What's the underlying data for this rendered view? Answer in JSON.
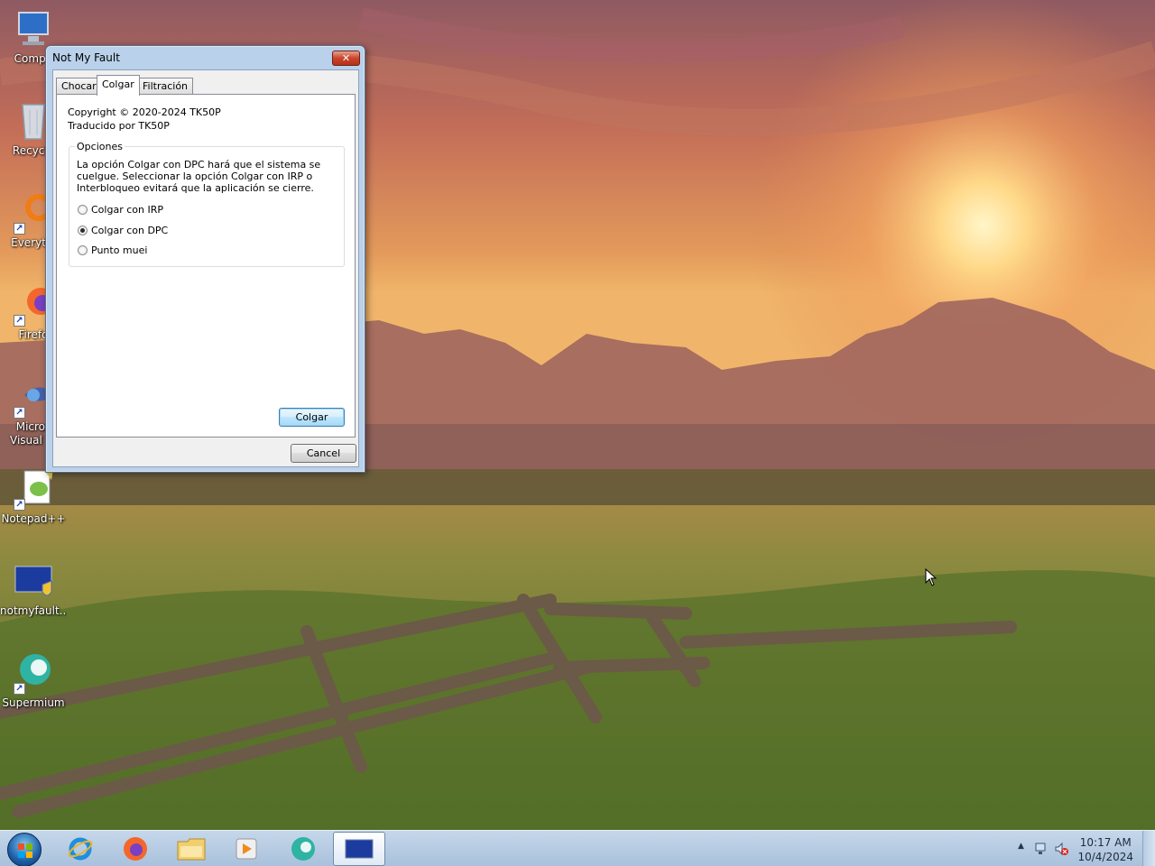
{
  "desktop": {
    "icons": [
      {
        "label": "Compu",
        "icon": "computer-icon"
      },
      {
        "label": "Recycle",
        "icon": "recycle-bin-icon"
      },
      {
        "label": "Everythi",
        "icon": "everything-icon"
      },
      {
        "label": "Firefo",
        "icon": "firefox-icon"
      },
      {
        "label": "Micros",
        "label2": "Visual St",
        "icon": "visual-studio-icon"
      },
      {
        "label": "Notepad++",
        "icon": "notepadpp-icon"
      },
      {
        "label": "notmyfault...",
        "icon": "notmyfault-icon"
      },
      {
        "label": "Supermium",
        "icon": "supermium-icon"
      }
    ]
  },
  "dialog": {
    "title": "Not My Fault",
    "close_label": "✕",
    "tabs": [
      "Chocar",
      "Colgar",
      "Filtración"
    ],
    "active_tab": "Colgar",
    "copyright": "Copyright © 2020-2024 TK50P",
    "translated": "Traducido por TK50P",
    "group": {
      "label": "Opciones",
      "description": "La opción Colgar con DPC hará que el sistema se cuelgue. Seleccionar la opción Colgar con IRP o Interbloqueo evitará que la aplicación se cierre.",
      "options": [
        {
          "label": "Colgar con IRP",
          "checked": false
        },
        {
          "label": "Colgar con DPC",
          "checked": true
        },
        {
          "label": "Punto muei",
          "checked": false
        }
      ]
    },
    "action_button": "Colgar",
    "cancel_button": "Cancel"
  },
  "taskbar": {
    "pinned": [
      "internet-explorer-icon",
      "firefox-icon",
      "file-explorer-icon",
      "media-player-icon",
      "supermium-icon",
      "notmyfault-icon"
    ],
    "active_app": "notmyfault-icon",
    "clock": {
      "time": "10:17 AM",
      "date": "10/4/2024"
    }
  }
}
